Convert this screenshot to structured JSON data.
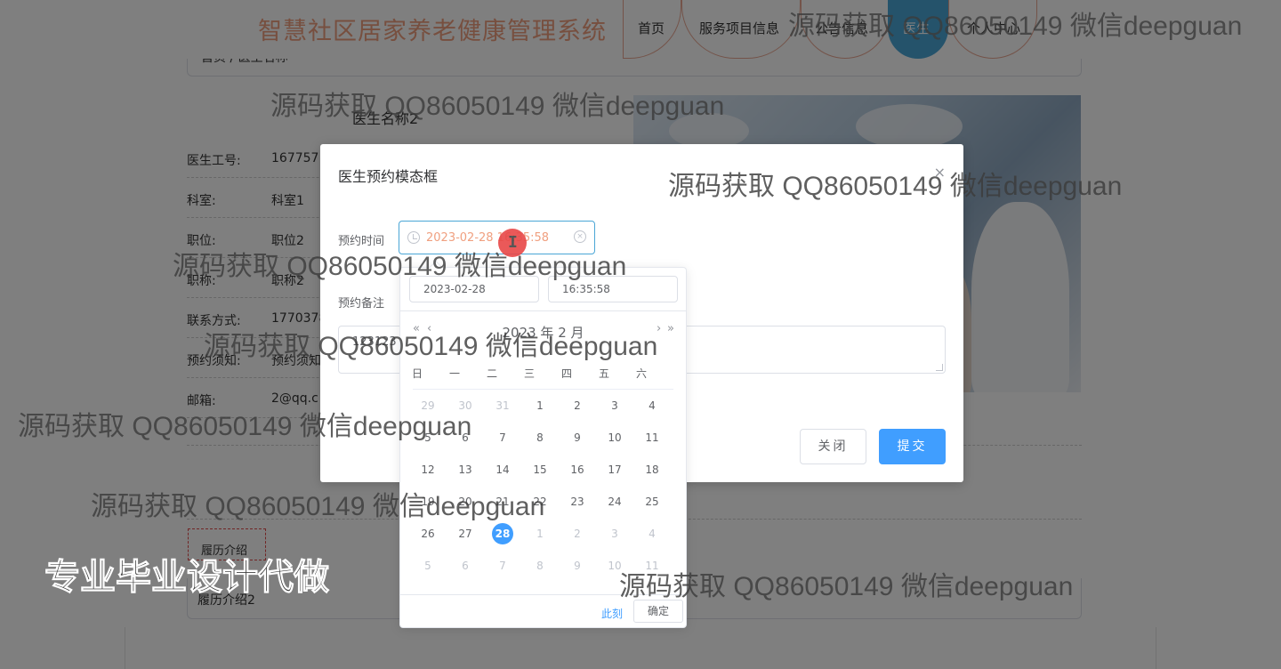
{
  "header": {
    "title": "智慧社区居家养老健康管理系统",
    "nav": [
      "首页",
      "服务项目信息",
      "公告信息",
      "医生",
      "个人中心"
    ],
    "active_nav": "医生",
    "accent_color": "#4aa6d6",
    "title_color": "#ef9f7f"
  },
  "page": {
    "breadcrumb": "首页 / 医生名称",
    "doctor_name": "医生名称2",
    "info": [
      {
        "label": "医生工号:",
        "value": "1677571"
      },
      {
        "label": "科室:",
        "value": "科室1"
      },
      {
        "label": "职位:",
        "value": "职位2"
      },
      {
        "label": "职称:",
        "value": "职称2"
      },
      {
        "label": "联系方式:",
        "value": "1770378"
      },
      {
        "label": "预约须知:",
        "value": "预约须知"
      },
      {
        "label": "邮箱:",
        "value": "2@qq.c"
      }
    ],
    "resume_tab": "履历介绍",
    "resume_text": "履历介绍2"
  },
  "modal": {
    "title": "医生预约模态框",
    "close_icon": "×",
    "time_label": "预约时间",
    "time_value": "2023-02-28 16:35:58",
    "remark_label": "预约备注",
    "remark_value": "123123",
    "close_button": "关闭",
    "submit_button": "提交"
  },
  "datepicker": {
    "date_input": "2023-02-28",
    "time_input": "16:35:58",
    "prev_year": "«",
    "prev_month": "‹",
    "next_month": "›",
    "next_year": "»",
    "month_label": "2023 年 2 月",
    "weekdays": [
      "日",
      "一",
      "二",
      "三",
      "四",
      "五",
      "六"
    ],
    "weeks": [
      [
        {
          "d": "29",
          "dim": true
        },
        {
          "d": "30",
          "dim": true
        },
        {
          "d": "31",
          "dim": true
        },
        {
          "d": "1"
        },
        {
          "d": "2"
        },
        {
          "d": "3"
        },
        {
          "d": "4"
        }
      ],
      [
        {
          "d": "5"
        },
        {
          "d": "6"
        },
        {
          "d": "7"
        },
        {
          "d": "8"
        },
        {
          "d": "9"
        },
        {
          "d": "10"
        },
        {
          "d": "11"
        }
      ],
      [
        {
          "d": "12"
        },
        {
          "d": "13"
        },
        {
          "d": "14"
        },
        {
          "d": "15"
        },
        {
          "d": "16"
        },
        {
          "d": "17"
        },
        {
          "d": "18"
        }
      ],
      [
        {
          "d": "19"
        },
        {
          "d": "20"
        },
        {
          "d": "21"
        },
        {
          "d": "22"
        },
        {
          "d": "23"
        },
        {
          "d": "24"
        },
        {
          "d": "25"
        }
      ],
      [
        {
          "d": "26"
        },
        {
          "d": "27"
        },
        {
          "d": "28",
          "today": true
        },
        {
          "d": "1",
          "dim": true
        },
        {
          "d": "2",
          "dim": true
        },
        {
          "d": "3",
          "dim": true
        },
        {
          "d": "4",
          "dim": true
        }
      ],
      [
        {
          "d": "5",
          "dim": true
        },
        {
          "d": "6",
          "dim": true
        },
        {
          "d": "7",
          "dim": true
        },
        {
          "d": "8",
          "dim": true
        },
        {
          "d": "9",
          "dim": true
        },
        {
          "d": "10",
          "dim": true
        },
        {
          "d": "11",
          "dim": true
        }
      ]
    ],
    "now_label": "此刻",
    "ok_label": "确定"
  },
  "watermarks": {
    "text": "源码获取 QQ86050149 微信deepguan",
    "big": "专业毕业设计代做"
  }
}
